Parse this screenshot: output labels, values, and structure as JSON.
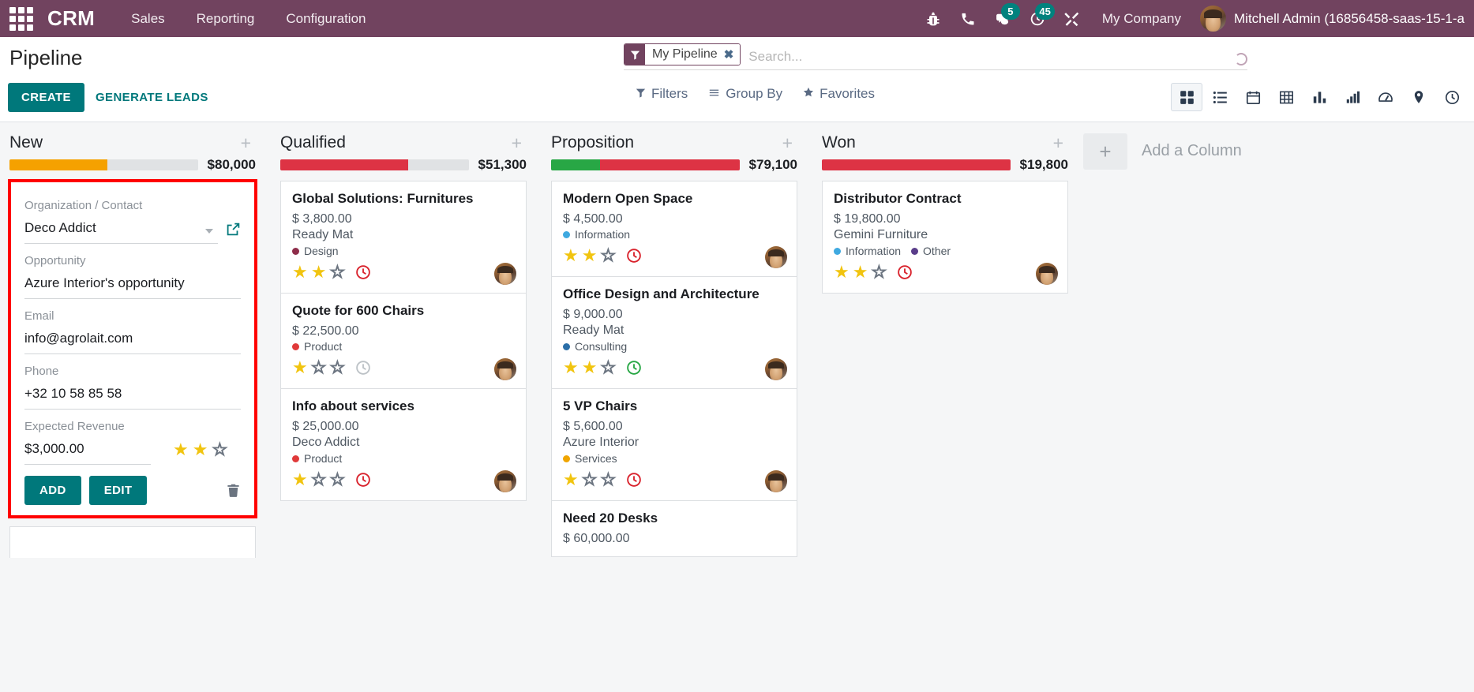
{
  "navbar": {
    "apps_icon": "apps-grid-icon",
    "brand": "CRM",
    "menu": [
      {
        "label": "Sales"
      },
      {
        "label": "Reporting"
      },
      {
        "label": "Configuration"
      }
    ],
    "sysicons": [
      {
        "name": "bug-icon",
        "badge": ""
      },
      {
        "name": "phone-icon",
        "badge": ""
      },
      {
        "name": "messages-icon",
        "badge": "5"
      },
      {
        "name": "activities-clock-icon",
        "badge": "45"
      },
      {
        "name": "tools-icon",
        "badge": ""
      }
    ],
    "company": "My Company",
    "user_name": "Mitchell Admin (16856458-saas-15-1-a",
    "bg_color": "#71435f",
    "badge_color": "#00827e"
  },
  "control_panel": {
    "page_title": "Pipeline",
    "create_label": "CREATE",
    "generate_leads_label": "GENERATE LEADS",
    "search": {
      "facet_label": "My Pipeline",
      "facet_remove": "✖",
      "placeholder": "Search..."
    },
    "filters": [
      {
        "label": "Filters",
        "icon": "filter-icon"
      },
      {
        "label": "Group By",
        "icon": "group-by-icon"
      },
      {
        "label": "Favorites",
        "icon": "star-icon"
      }
    ],
    "views": [
      {
        "name": "kanban-view-icon",
        "active": true
      },
      {
        "name": "list-view-icon",
        "active": false
      },
      {
        "name": "calendar-view-icon",
        "active": false
      },
      {
        "name": "pivot-view-icon",
        "active": false
      },
      {
        "name": "graph-bar-view-icon",
        "active": false
      },
      {
        "name": "graph-line-view-icon",
        "active": false
      },
      {
        "name": "dashboard-view-icon",
        "active": false
      },
      {
        "name": "map-view-icon",
        "active": false
      },
      {
        "name": "activity-view-icon",
        "active": false
      }
    ]
  },
  "kanban": {
    "add_column_label": "Add a Column",
    "columns": [
      {
        "title": "New",
        "amount": "$80,000",
        "progress": [
          {
            "color": "#f5a100",
            "pct": 52
          }
        ],
        "cards": []
      },
      {
        "title": "Qualified",
        "amount": "$51,300",
        "progress": [
          {
            "color": "#dd3344",
            "pct": 68
          }
        ],
        "cards": [
          {
            "title": "Global Solutions: Furnitures",
            "amount": "$ 3,800.00",
            "partner": "Ready Mat",
            "tags": [
              {
                "label": "Design",
                "color": "#8e2d4a"
              }
            ],
            "stars": 2,
            "clock_color": "#d9232d",
            "avatar": "user-avatar"
          },
          {
            "title": "Quote for 600 Chairs",
            "amount": "$ 22,500.00",
            "partner": "",
            "tags": [
              {
                "label": "Product",
                "color": "#e03a3a"
              }
            ],
            "stars": 1,
            "clock_color": "#bdc3c7",
            "avatar": "user-avatar"
          },
          {
            "title": "Info about services",
            "amount": "$ 25,000.00",
            "partner": "Deco Addict",
            "tags": [
              {
                "label": "Product",
                "color": "#e03a3a"
              }
            ],
            "stars": 1,
            "clock_color": "#d9232d",
            "avatar": "user-avatar"
          }
        ]
      },
      {
        "title": "Proposition",
        "amount": "$79,100",
        "progress": [
          {
            "color": "#28a745",
            "pct": 26
          },
          {
            "color": "#dd3344",
            "pct": 74
          }
        ],
        "cards": [
          {
            "title": "Modern Open Space",
            "amount": "$ 4,500.00",
            "partner": "",
            "tags": [
              {
                "label": "Information",
                "color": "#3fa9e0"
              }
            ],
            "stars": 2,
            "clock_color": "#d9232d",
            "avatar": "user-avatar"
          },
          {
            "title": "Office Design and Architecture",
            "amount": "$ 9,000.00",
            "partner": "Ready Mat",
            "tags": [
              {
                "label": "Consulting",
                "color": "#2b6fa8"
              }
            ],
            "stars": 2,
            "clock_color": "#28a745",
            "avatar": "user-avatar"
          },
          {
            "title": "5 VP Chairs",
            "amount": "$ 5,600.00",
            "partner": "Azure Interior",
            "tags": [
              {
                "label": "Services",
                "color": "#f0a500"
              }
            ],
            "stars": 1,
            "clock_color": "#d9232d",
            "avatar": "user-avatar"
          },
          {
            "title": "Need 20 Desks",
            "amount": "$ 60,000.00",
            "partner": "",
            "tags": [],
            "stars": 0,
            "clock_color": "",
            "avatar": ""
          }
        ]
      },
      {
        "title": "Won",
        "amount": "$19,800",
        "progress": [
          {
            "color": "#dd3344",
            "pct": 100
          }
        ],
        "cards": [
          {
            "title": "Distributor Contract",
            "amount": "$ 19,800.00",
            "partner": "Gemini Furniture",
            "tags": [
              {
                "label": "Information",
                "color": "#3fa9e0"
              },
              {
                "label": "Other",
                "color": "#5a3d8a"
              }
            ],
            "stars": 2,
            "clock_color": "#d9232d",
            "avatar": "user-avatar"
          }
        ]
      }
    ]
  },
  "quick_create": {
    "highlight_color": "#ff0000",
    "fields": [
      {
        "label": "Organization / Contact",
        "value": "Deco Addict",
        "type": "select"
      },
      {
        "label": "Opportunity",
        "value": "Azure Interior's opportunity",
        "type": "text"
      },
      {
        "label": "Email",
        "value": "info@agrolait.com",
        "type": "text"
      },
      {
        "label": "Phone",
        "value": "+32 10 58 85 58",
        "type": "text"
      }
    ],
    "revenue_label": "Expected Revenue",
    "revenue_value": "$3,000.00",
    "revenue_stars": 2,
    "add_label": "ADD",
    "edit_label": "EDIT",
    "trash_icon": "trash-icon",
    "external_link_icon": "external-link-icon"
  }
}
